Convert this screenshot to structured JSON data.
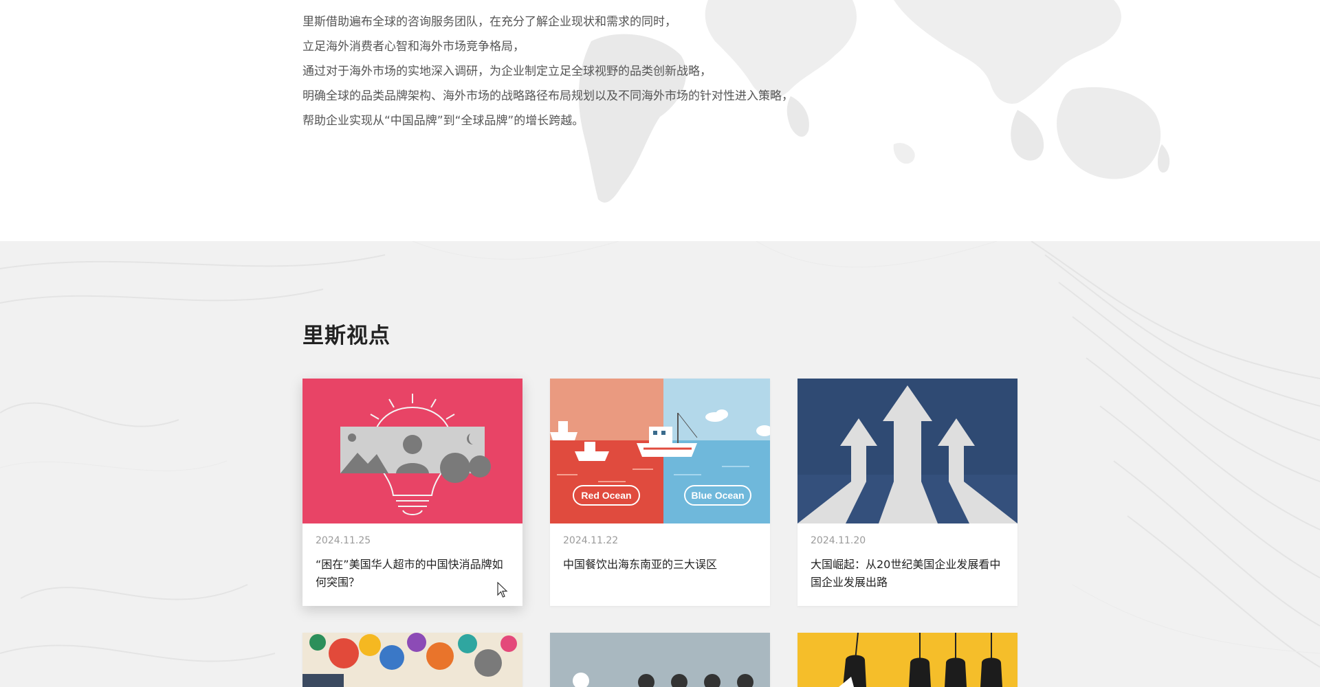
{
  "intro": {
    "lines": [
      "里斯借助遍布全球的咨询服务团队，在充分了解企业现状和需求的同时，",
      "立足海外消费者心智和海外市场竞争格局，",
      "通过对于海外市场的实地深入调研，为企业制定立足全球视野的品类创新战略，",
      "明确全球的品类品牌架构、海外市场的战略路径布局规划以及不同海外市场的针对性进入策略，",
      "帮助企业实现从“中国品牌”到“全球品牌”的增长跨越。"
    ]
  },
  "insights": {
    "title": "里斯视点",
    "articles": [
      {
        "date": "2024.11.25",
        "title": "“困在”美国华人超市的中国快消品牌如何突围？",
        "image": "lightbulb-photos-illustration",
        "accent": "#e84466"
      },
      {
        "date": "2024.11.22",
        "title": "中国餐饮出海东南亚的三大误区",
        "image": "red-ocean-blue-ocean-illustration",
        "image_labels": {
          "left": "Red Ocean",
          "right": "Blue Ocean"
        },
        "accent": "#e04b3e"
      },
      {
        "date": "2024.11.20",
        "title": "大国崛起：从20世纪美国企业发展看中国企业发展出路",
        "image": "rising-arrows-illustration",
        "accent": "#2f4a73"
      }
    ],
    "next_row": [
      {
        "image": "colorful-icons-illustration"
      },
      {
        "image": "gray-dots-illustration"
      },
      {
        "image": "yellow-hanging-lamps-illustration"
      }
    ]
  },
  "colors": {
    "body_text": "#555555",
    "heading": "#222222",
    "date": "#9a9a9a",
    "section_bg": "#f1f1f1"
  },
  "icons": [
    "world-map-background",
    "swirl-background",
    "mouse-cursor-icon"
  ]
}
